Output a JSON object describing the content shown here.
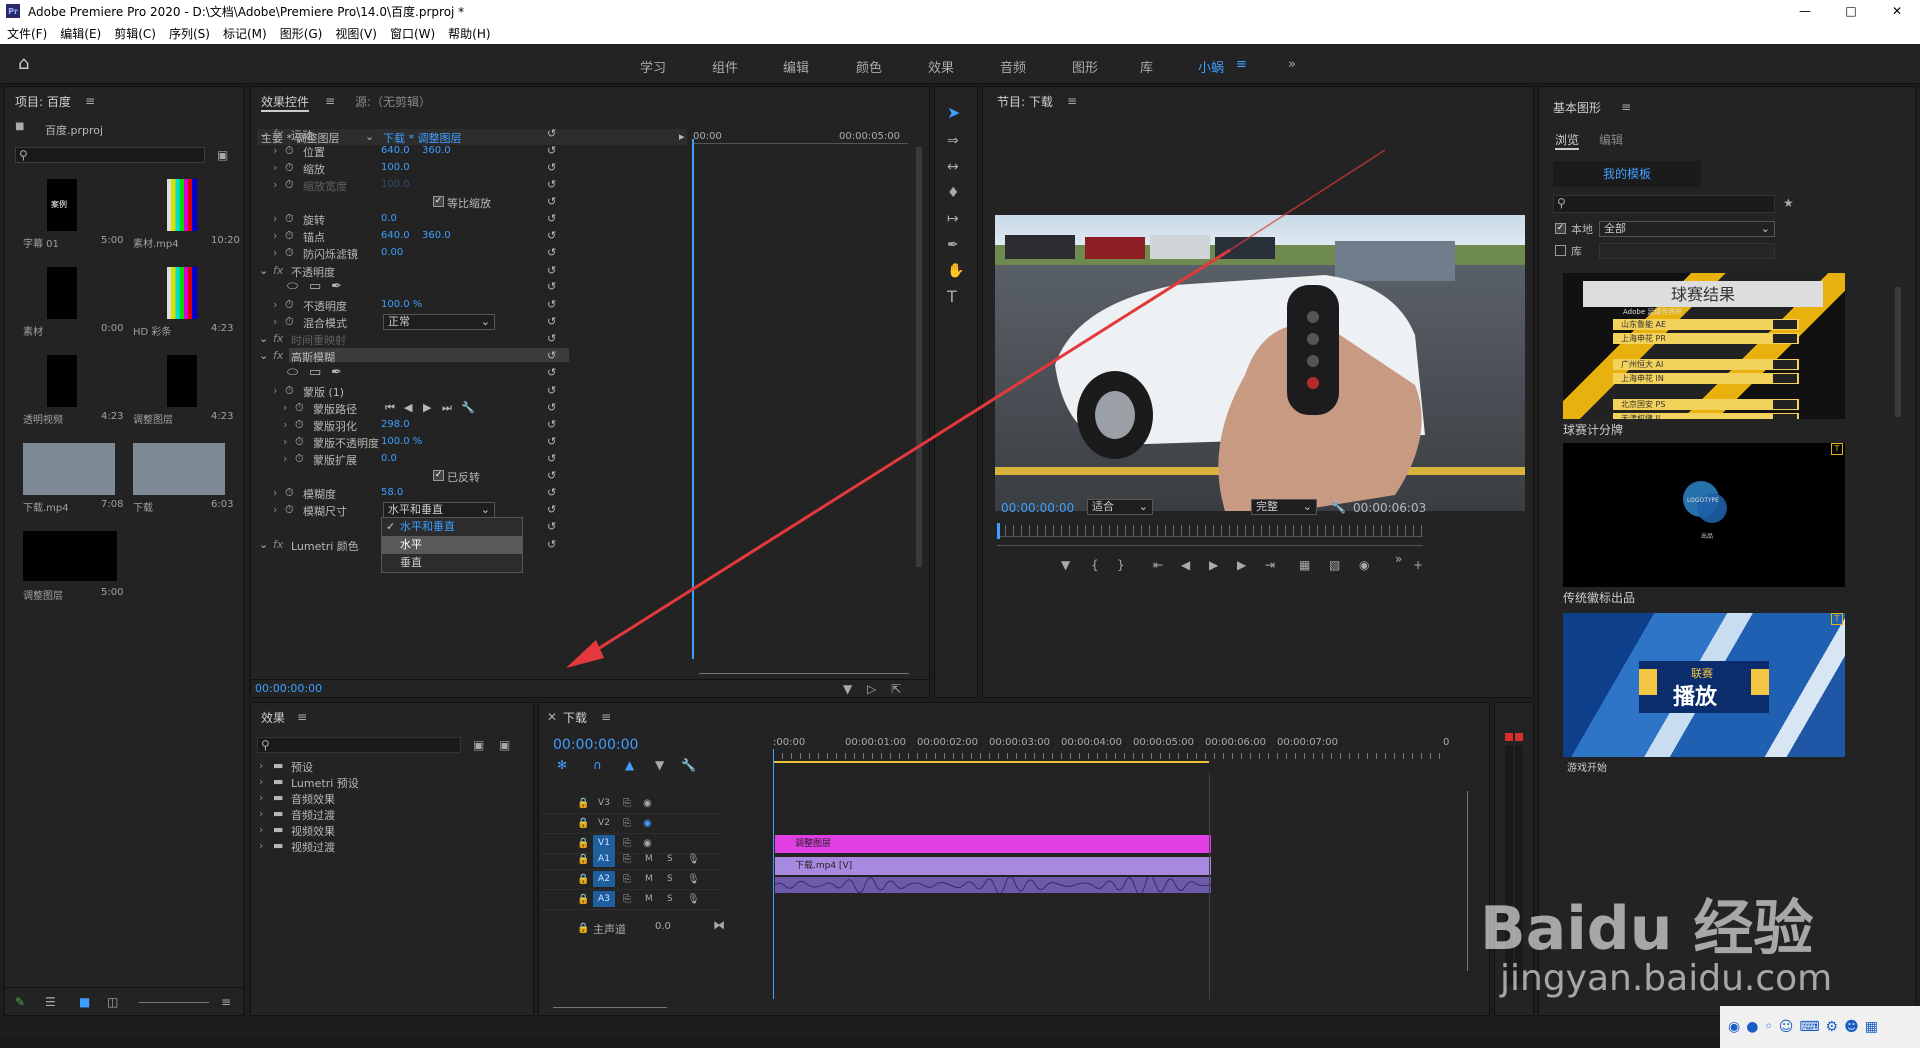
{
  "window": {
    "title": "Adobe Premiere Pro 2020 - D:\\文档\\Adobe\\Premiere Pro\\14.0\\百度.prproj *",
    "app_logo": "Pr"
  },
  "menu": [
    "文件(F)",
    "编辑(E)",
    "剪辑(C)",
    "序列(S)",
    "标记(M)",
    "图形(G)",
    "视图(V)",
    "窗口(W)",
    "帮助(H)"
  ],
  "workspaces": [
    "学习",
    "组件",
    "编辑",
    "颜色",
    "效果",
    "音频",
    "图形",
    "库",
    "小蜗",
    "»"
  ],
  "project": {
    "title": "项目: 百度",
    "file": "百度.prproj",
    "items": [
      {
        "name": "字幕 01",
        "dur": "5:00",
        "thumb_text": "案例"
      },
      {
        "name": "素材.mp4",
        "dur": "10:20"
      },
      {
        "name": "素材",
        "dur": "0:00"
      },
      {
        "name": "HD 彩条",
        "dur": "4:23"
      },
      {
        "name": "透明视频",
        "dur": "4:23"
      },
      {
        "name": "调整图层",
        "dur": "4:23"
      },
      {
        "name": "下载.mp4",
        "dur": "7:08"
      },
      {
        "name": "下载",
        "dur": "6:03"
      },
      {
        "name": "调整图层",
        "dur": "5:00"
      }
    ]
  },
  "effect_controls": {
    "tab1": "效果控件",
    "tab2": "源:（无剪辑）",
    "master": "主要 * 调整图层",
    "clip": "下载 * 调整图层",
    "time_start": "00:00",
    "time_end": "00:00:05:00",
    "current_time": "00:00:00:00",
    "rows": [
      {
        "label": "运动",
        "level": 0,
        "fx": true
      },
      {
        "label": "位置",
        "level": 1,
        "v1": "640.0",
        "v2": "360.0"
      },
      {
        "label": "缩放",
        "level": 1,
        "v1": "100.0"
      },
      {
        "label": "缩放宽度",
        "level": 1,
        "v1": "100.0",
        "dim": true
      },
      {
        "label": "等比缩放",
        "level": 2,
        "check": true
      },
      {
        "label": "旋转",
        "level": 1,
        "v1": "0.0"
      },
      {
        "label": "锚点",
        "level": 1,
        "v1": "640.0",
        "v2": "360.0"
      },
      {
        "label": "防闪烁滤镜",
        "level": 1,
        "v1": "0.00"
      },
      {
        "label": "不透明度",
        "level": 0,
        "fx": true
      },
      {
        "label": "",
        "level": 1,
        "shapes": true
      },
      {
        "label": "不透明度",
        "level": 1,
        "v1": "100.0 %"
      },
      {
        "label": "混合模式",
        "level": 1,
        "dd": "正常"
      },
      {
        "label": "时间重映射",
        "level": 0,
        "fx": true,
        "dim": true
      },
      {
        "label": "高斯模糊",
        "level": 0,
        "fx": true,
        "hl": true
      },
      {
        "label": "",
        "level": 1,
        "shapes": true
      },
      {
        "label": "蒙版 (1)",
        "level": 1
      },
      {
        "label": "蒙版路径",
        "level": 2,
        "track": true
      },
      {
        "label": "蒙版羽化",
        "level": 2,
        "v1": "298.0"
      },
      {
        "label": "蒙版不透明度",
        "level": 2,
        "v1": "100.0 %"
      },
      {
        "label": "蒙版扩展",
        "level": 2,
        "v1": "0.0"
      },
      {
        "label": "已反转",
        "level": 2,
        "check": true
      },
      {
        "label": "模糊度",
        "level": 1,
        "v1": "58.0"
      },
      {
        "label": "模糊尺寸",
        "level": 1,
        "dd": "水平和垂直"
      },
      {
        "label": "",
        "level": 1
      },
      {
        "label": "Lumetri 颜色",
        "level": 0,
        "fx": true
      }
    ],
    "dropdown_menu": [
      "水平和垂直",
      "水平",
      "垂直"
    ],
    "dropdown_selected": "水平和垂直",
    "dropdown_hover": "水平"
  },
  "program": {
    "title": "节目: 下载",
    "timecode": "00:00:00:00",
    "fit": "适合",
    "quality": "完整",
    "duration": "00:00:06:03"
  },
  "effects": {
    "title": "效果",
    "folders": [
      "预设",
      "Lumetri 预设",
      "音频效果",
      "音频过渡",
      "视频效果",
      "视频过渡"
    ]
  },
  "timeline": {
    "title": "下载",
    "timecode": "00:00:00:00",
    "ticks": [
      ":00:00",
      "00:00:01:00",
      "00:00:02:00",
      "00:00:03:00",
      "00:00:04:00",
      "00:00:05:00",
      "00:00:06:00",
      "00:00:07:00",
      "0"
    ],
    "video_tracks": [
      "V3",
      "V2",
      "V1"
    ],
    "audio_tracks": [
      "A1",
      "A2",
      "A3"
    ],
    "master": "主声道",
    "master_val": "0.0",
    "clips": {
      "v2": "调整图层",
      "v1": "下载.mp4 [V]"
    }
  },
  "graphics": {
    "title": "基本图形",
    "tab_browse": "浏览",
    "tab_edit": "编辑",
    "my_templates": "我的模板",
    "local_label": "本地",
    "local_value": "全部",
    "lib_label": "库",
    "templates": [
      {
        "name": "球赛计分牌",
        "header": "球赛结果",
        "sub": "Adobe 足球世界杯",
        "rows": [
          "山东鲁能 AE",
          "上海申花 PR",
          "广州恒大 AI",
          "上海申花 IN",
          "北京国安 PS",
          "天津权健 IL"
        ]
      },
      {
        "name": "传统徽标出品",
        "logo": "LOGOTYPE",
        "sub": "出品"
      },
      {
        "name": "游戏开始",
        "league": "联赛",
        "big": "播放"
      }
    ]
  },
  "watermark": {
    "brand": "Baidu 经验",
    "url": "jingyan.baidu.com"
  },
  "colors": {
    "accent": "#3e9fff",
    "v2_clip": "#e23ee5",
    "v1_clip": "#a78ae0",
    "arrow": "#e4393c"
  }
}
